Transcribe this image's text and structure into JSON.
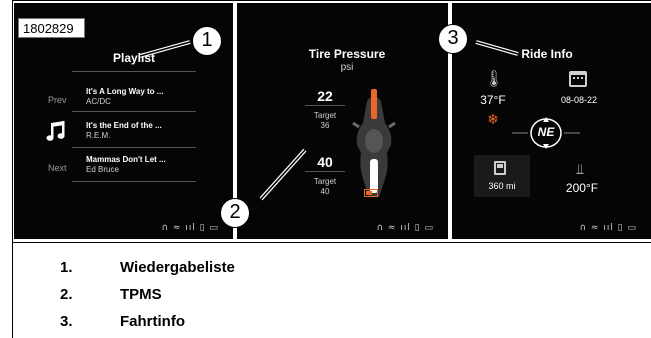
{
  "image_id": "1802829",
  "status_bar": "∩ ≈ ııl ▯ ▭",
  "screens": {
    "playlist": {
      "title": "Playlist",
      "prev_label": "Prev",
      "next_label": "Next",
      "songs": [
        {
          "title": "It's A Long Way to ...",
          "artist": "AC/DC"
        },
        {
          "title": "It's the End of the ...",
          "artist": "R.E.M."
        },
        {
          "title": "Mammas Don't Let ...",
          "artist": "Ed Bruce"
        }
      ]
    },
    "tpms": {
      "title": "Tire Pressure",
      "unit": "psi",
      "front": {
        "value": "22",
        "target_label": "Target",
        "target": "36"
      },
      "rear": {
        "value": "40",
        "target_label": "Target",
        "target": "40"
      },
      "front_color": "#e8672a",
      "rear_color": "#ffffff"
    },
    "ride_info": {
      "title": "Ride Info",
      "ambient_temp": "37°F",
      "date": "08-08-22",
      "compass": "NE",
      "range": "360 mi",
      "engine_temp": "200°F",
      "snow_color": "#e8672a"
    }
  },
  "callouts": [
    "1",
    "2",
    "3"
  ],
  "legend": [
    {
      "num": "1.",
      "text": "Wiedergabeliste"
    },
    {
      "num": "2.",
      "text": "TPMS"
    },
    {
      "num": "3.",
      "text": "Fahrtinfo"
    }
  ]
}
